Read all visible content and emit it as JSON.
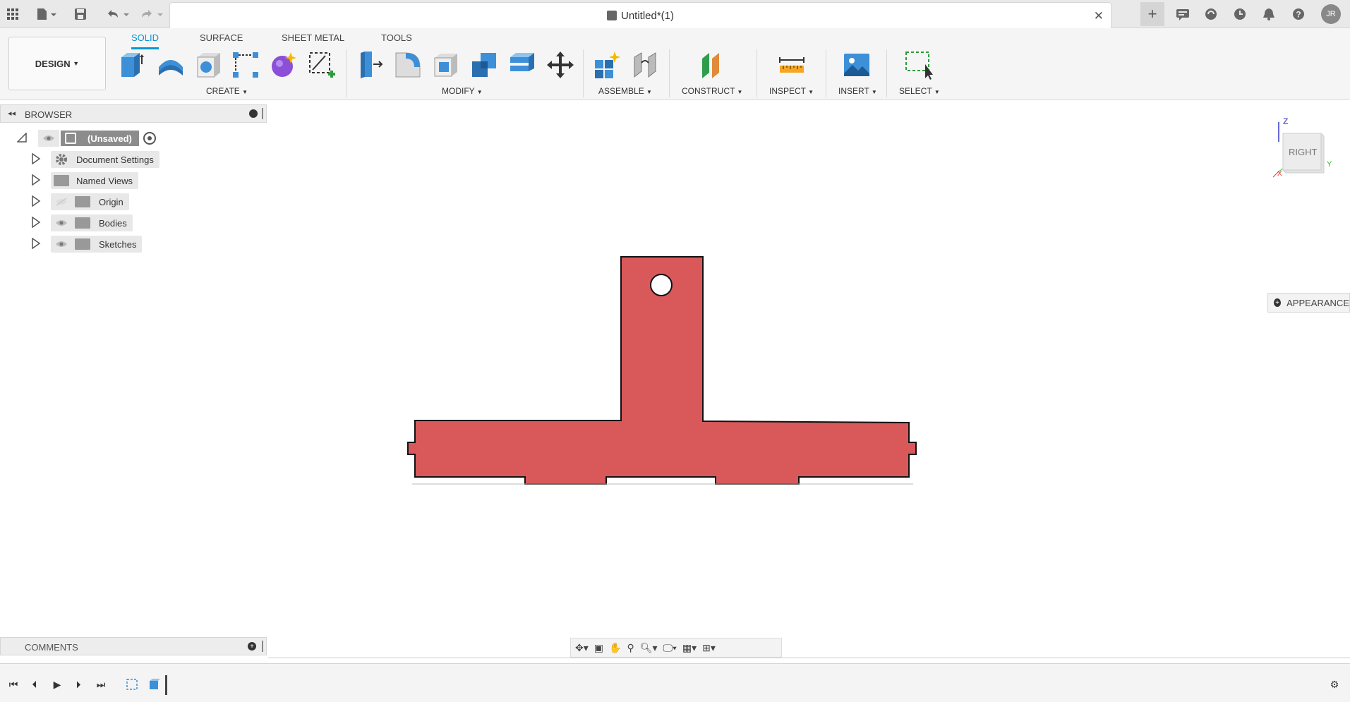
{
  "window": {
    "title": "Untitled*(1)",
    "user_initials": "JR"
  },
  "workspace": {
    "mode": "DESIGN"
  },
  "ribbon": {
    "tabs": [
      "SOLID",
      "SURFACE",
      "SHEET METAL",
      "TOOLS"
    ],
    "active_tab": "SOLID",
    "groups": [
      "CREATE",
      "MODIFY",
      "ASSEMBLE",
      "CONSTRUCT",
      "INSPECT",
      "INSERT",
      "SELECT"
    ]
  },
  "browser": {
    "label": "BROWSER",
    "root": "(Unsaved)",
    "items": [
      {
        "label": "Document Settings",
        "icon": "gear-icon"
      },
      {
        "label": "Named Views",
        "icon": "folder-icon"
      },
      {
        "label": "Origin",
        "icon": "folder-icon"
      },
      {
        "label": "Bodies",
        "icon": "folder-icon"
      },
      {
        "label": "Sketches",
        "icon": "folder-icon"
      }
    ]
  },
  "comments": {
    "label": "COMMENTS"
  },
  "viewcube": {
    "face": "RIGHT",
    "axes": {
      "z": "Z",
      "y": "Y",
      "x": "X"
    }
  },
  "appearance_panel": {
    "label": "APPEARANCE"
  },
  "colors": {
    "accent": "#0696d7",
    "body_fill": "#d9595b",
    "outline": "#111111"
  }
}
